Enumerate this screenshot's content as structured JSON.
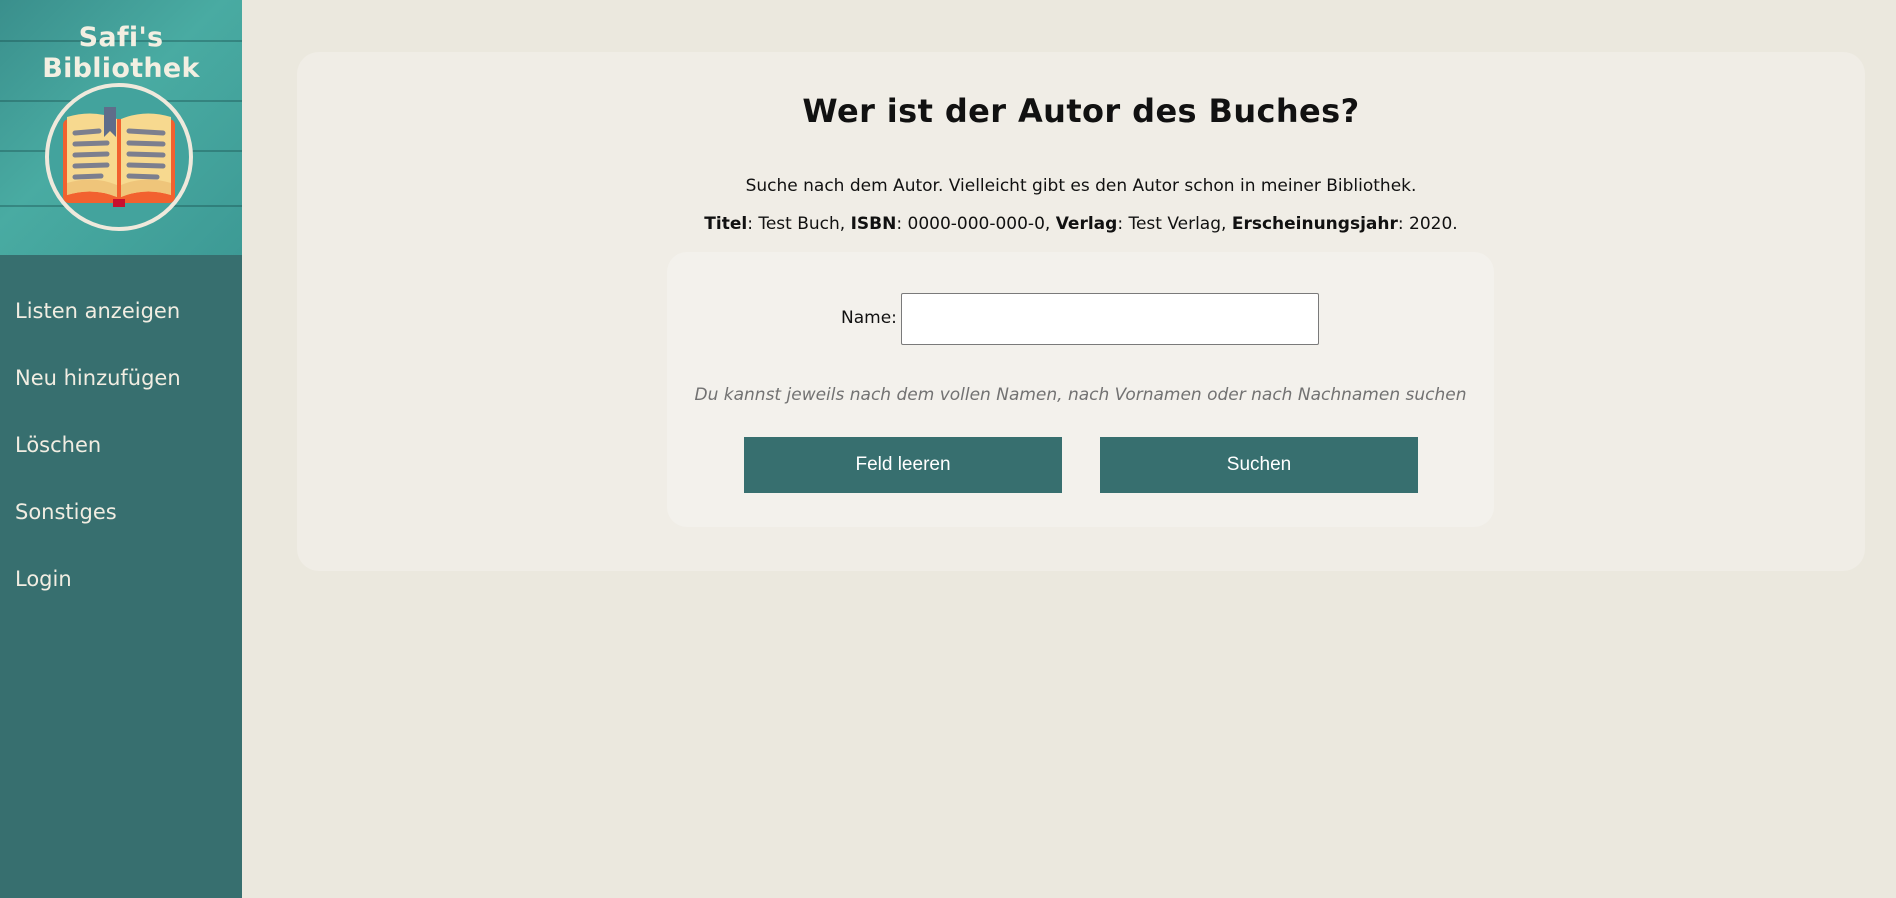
{
  "sidebar": {
    "title": "Safi's Bibliothek",
    "logo_icon": "open-book-icon",
    "nav_items": [
      {
        "label": "Listen anzeigen"
      },
      {
        "label": "Neu hinzufügen"
      },
      {
        "label": "Löschen"
      },
      {
        "label": "Sonstiges"
      },
      {
        "label": "Login"
      }
    ]
  },
  "main": {
    "title": "Wer ist der Autor des Buches?",
    "intro": "Suche nach dem Autor. Vielleicht gibt es den Autor schon in meiner Bibliothek.",
    "book": {
      "title_label": "Titel",
      "title_value": ": Test Buch, ",
      "isbn_label": "ISBN",
      "isbn_value": ": 0000-000-000-0, ",
      "publisher_label": "Verlag",
      "publisher_value": ": Test Verlag, ",
      "year_label": "Erscheinungsjahr",
      "year_value": ": 2020."
    },
    "search": {
      "name_label": "Name:",
      "name_value": "",
      "hint": "Du kannst jeweils nach dem vollen Namen, nach Vornamen oder nach Nachnamen suchen",
      "clear_button": "Feld leeren",
      "search_button": "Suchen"
    }
  },
  "colors": {
    "sidebar_bg": "#376f6f",
    "page_bg": "#ebe8de",
    "card_bg": "#f0ede6",
    "button_bg": "#376f6f"
  }
}
